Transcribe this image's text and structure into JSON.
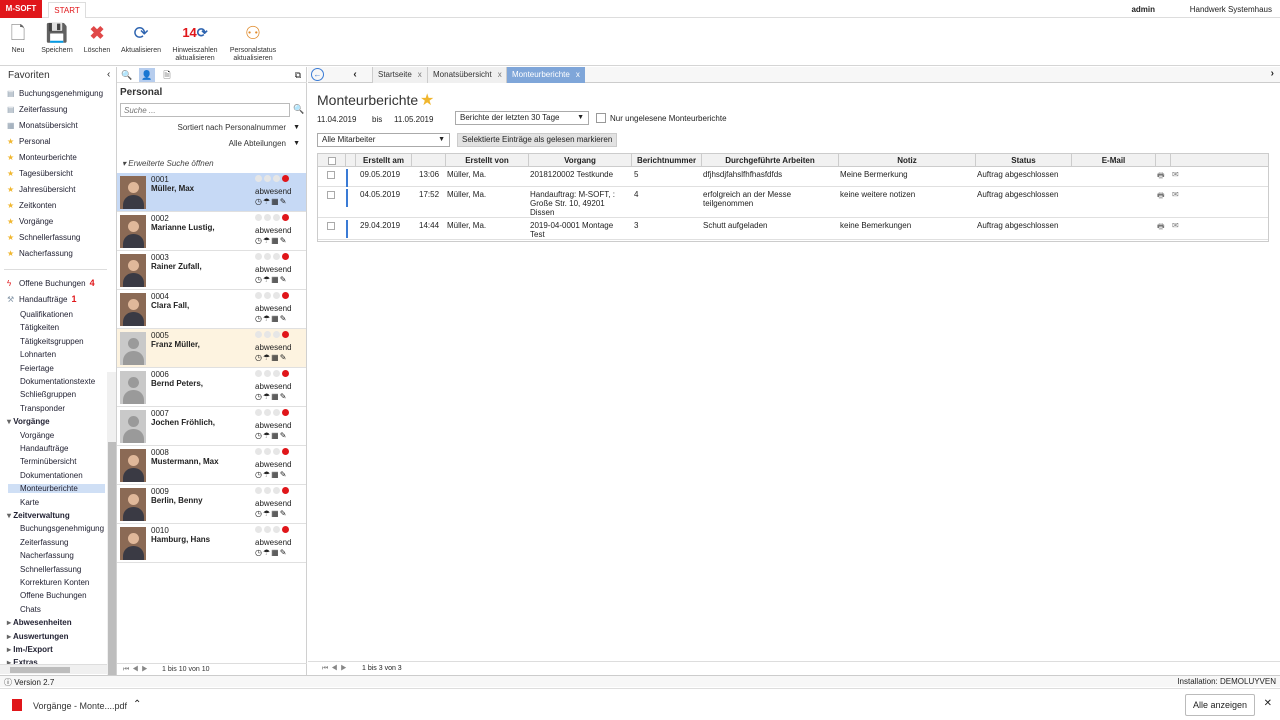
{
  "topbar": {
    "brand": "M-SOFT",
    "tab": "START",
    "user": "admin",
    "company": "Handwerk Systemhaus"
  },
  "ribbon": {
    "buttons": [
      {
        "label": "Neu",
        "icon": "new-file-icon"
      },
      {
        "label": "Speichern",
        "icon": "save-icon"
      },
      {
        "label": "Löschen",
        "icon": "delete-icon"
      },
      {
        "label": "Aktualisieren",
        "icon": "refresh-icon"
      },
      {
        "label": "Hinweiszahlen aktualisieren",
        "icon": "refresh-notices-icon",
        "count": "14"
      },
      {
        "label": "Personalstatus aktualisieren",
        "icon": "refresh-status-icon"
      }
    ]
  },
  "favorites": {
    "title": "Favoriten",
    "items": [
      "Buchungsgenehmigung",
      "Zeiterfassung",
      "Monatsübersicht",
      "Personal",
      "Monteurberichte",
      "Tagesübersicht",
      "Jahresübersicht",
      "Zeitkonten",
      "Vorgänge",
      "Schnellerfassung",
      "Nacherfassung"
    ],
    "alerts": [
      {
        "label": "Offene Buchungen",
        "count": "4"
      },
      {
        "label": "Handaufträge",
        "count": "1"
      }
    ],
    "tree": [
      {
        "label": "Qualifikationen",
        "level": 2
      },
      {
        "label": "Tätigkeiten",
        "level": 2
      },
      {
        "label": "Tätigkeitsgruppen",
        "level": 2
      },
      {
        "label": "Lohnarten",
        "level": 2
      },
      {
        "label": "Feiertage",
        "level": 2
      },
      {
        "label": "Dokumentationstexte",
        "level": 2
      },
      {
        "label": "Schließgruppen",
        "level": 2
      },
      {
        "label": "Transponder",
        "level": 2
      },
      {
        "label": "Vorgänge",
        "level": 1,
        "open": true
      },
      {
        "label": "Vorgänge",
        "level": 2
      },
      {
        "label": "Handaufträge",
        "level": 2
      },
      {
        "label": "Terminübersicht",
        "level": 2
      },
      {
        "label": "Dokumentationen",
        "level": 2
      },
      {
        "label": "Monteurberichte",
        "level": 2,
        "selected": true
      },
      {
        "label": "Karte",
        "level": 2
      },
      {
        "label": "Zeitverwaltung",
        "level": 1,
        "open": true
      },
      {
        "label": "Buchungsgenehmigung",
        "level": 2
      },
      {
        "label": "Zeiterfassung",
        "level": 2
      },
      {
        "label": "Nacherfassung",
        "level": 2
      },
      {
        "label": "Schnellerfassung",
        "level": 2
      },
      {
        "label": "Korrekturen Konten",
        "level": 2
      },
      {
        "label": "Offene Buchungen",
        "level": 2
      },
      {
        "label": "Chats",
        "level": 2
      },
      {
        "label": "Abwesenheiten",
        "level": 1
      },
      {
        "label": "Auswertungen",
        "level": 1
      },
      {
        "label": "Im-/Export",
        "level": 1
      },
      {
        "label": "Extras",
        "level": 1
      }
    ]
  },
  "personal": {
    "title": "Personal",
    "search_placeholder": "Suche ...",
    "sort": "Sortiert nach Personalnummer",
    "department": "Alle Abteilungen",
    "extended_search": "Erweiterte Suche öffnen",
    "status_label": "abwesend",
    "rows": [
      {
        "num": "0001",
        "name": "Müller, Max",
        "photo": true
      },
      {
        "num": "0002",
        "name": "Marianne Lustig,",
        "photo": true
      },
      {
        "num": "0003",
        "name": "Rainer Zufall,",
        "photo": true
      },
      {
        "num": "0004",
        "name": "Clara Fall,",
        "photo": true
      },
      {
        "num": "0005",
        "name": "Franz Müller,",
        "photo": false
      },
      {
        "num": "0006",
        "name": "Bernd Peters,",
        "photo": false
      },
      {
        "num": "0007",
        "name": "Jochen Fröhlich,",
        "photo": false
      },
      {
        "num": "0008",
        "name": "Mustermann, Max",
        "photo": true
      },
      {
        "num": "0009",
        "name": "Berlin, Benny",
        "photo": true
      },
      {
        "num": "0010",
        "name": "Hamburg, Hans",
        "photo": true
      }
    ],
    "pager": "1 bis 10 von 10"
  },
  "tabs": [
    {
      "label": "Startseite"
    },
    {
      "label": "Monatsübersicht"
    },
    {
      "label": "Monteurberichte",
      "active": true
    }
  ],
  "main": {
    "title": "Monteurberichte",
    "date_from": "11.04.2019",
    "bis": "bis",
    "date_to": "11.05.2019",
    "range_select": "Berichte der letzten 30 Tage",
    "unread_label": "Nur ungelesene Monteurberichte",
    "employee_select": "Alle Mitarbeiter",
    "mark_button": "Selektierte Einträge als gelesen markieren",
    "columns": [
      "Erstellt am",
      "Erstellt von",
      "Vorgang",
      "Berichtnummer",
      "Durchgeführte Arbeiten",
      "Notiz",
      "Status",
      "E-Mail"
    ],
    "rows": [
      {
        "date": "09.05.2019",
        "time": "13:06",
        "by": "Müller, Ma.",
        "vorgang": "2018120002 Testkunde",
        "nr": "5",
        "arbeiten": "dfjhsdjfahslfhfhasfdfds",
        "notiz": "Meine Bermerkung",
        "status": "Auftrag abgeschlossen"
      },
      {
        "date": "04.05.2019",
        "time": "17:52",
        "by": "Müller, Ma.",
        "vorgang": "Handauftrag: M-SOFT, : Große Str. 10, 49201 Dissen",
        "nr": "4",
        "arbeiten": "erfolgreich an der Messe teilgenommen",
        "notiz": "keine weitere notizen",
        "status": "Auftrag abgeschlossen"
      },
      {
        "date": "29.04.2019",
        "time": "14:44",
        "by": "Müller, Ma.",
        "vorgang": "2019-04-0001 Montage Test",
        "nr": "3",
        "arbeiten": "Schutt aufgeladen",
        "notiz": "keine Bemerkungen",
        "status": "Auftrag abgeschlossen"
      }
    ],
    "pager": "1 bis 3 von 3"
  },
  "statusbar": {
    "version": "Version 2.7",
    "install": "Installation: DEMOLUYVEN"
  },
  "download": {
    "file": "Vorgänge - Monte....pdf",
    "show_all": "Alle anzeigen"
  }
}
